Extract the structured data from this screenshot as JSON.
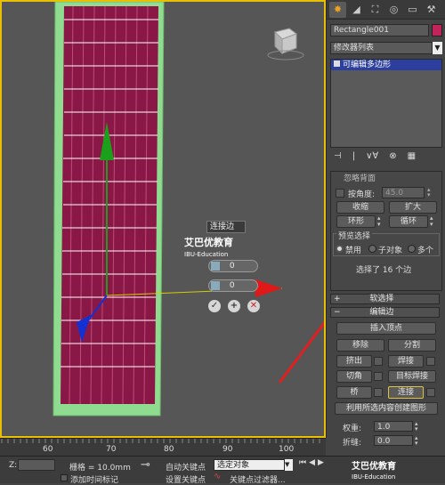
{
  "command_panel": {
    "tabs": [
      "✸",
      "◢",
      "⛶",
      "◎",
      "▭",
      "⚒"
    ],
    "object_name": "Rectangle001",
    "modifier_list_label": "修改器列表",
    "stack_item": "可编辑多边形",
    "stack_toolbar": [
      "⊣",
      "|",
      "∨∀",
      "⊗",
      "▦"
    ]
  },
  "selection_rollout": {
    "ignore_backface": "忽略背面",
    "by_angle_label": "按角度:",
    "by_angle_value": "45.0",
    "shrink": "收缩",
    "grow": "扩大",
    "ring": "环形",
    "loop": "循环",
    "preview_selection": "预览选择",
    "preview_options": [
      "禁用",
      "子对象",
      "多个"
    ],
    "selected_status": "选择了 16 个边"
  },
  "soft_selection_label": "软选择",
  "edit_edges": {
    "header": "编辑边",
    "insert_vertex": "插入顶点",
    "remove": "移除",
    "split": "分割",
    "extrude": "挤出",
    "weld": "焊接",
    "chamfer": "切角",
    "target_weld": "目标焊接",
    "bridge": "桥",
    "connect": "连接",
    "create_shape": "利用所选内容创建图形",
    "weight_label": "权重:",
    "weight_value": "1.0",
    "crease_label": "折缝:",
    "crease_value": "0.0"
  },
  "caddy": {
    "title": "连接边",
    "segments_value": "0",
    "pinch_value": "0"
  },
  "watermark": {
    "name": "艾巴优教育",
    "sub": "IBU-Education"
  },
  "ruler_ticks": [
    "60",
    "70",
    "80",
    "90",
    "100"
  ],
  "statusbar": {
    "z_label": "Z:",
    "grid_label": "栅格 = 10.0mm",
    "auto_key": "自动关键点",
    "selected_obj": "选定对象",
    "set_key": "设置关键点",
    "key_filters": "关键点过滤器...",
    "add_time_tag": "添加时间标记"
  },
  "colors": {
    "accent": "#f0a020",
    "selection_border": "#e8c000",
    "mesh_fill": "#8a1846",
    "frame_green": "#8fdb8f",
    "gizmo_green": "#1aa01a",
    "gizmo_blue": "#1530d0",
    "gizmo_red": "#e01818",
    "stack_highlight": "#2d3f9e",
    "color_swatch": "#c0245a"
  }
}
